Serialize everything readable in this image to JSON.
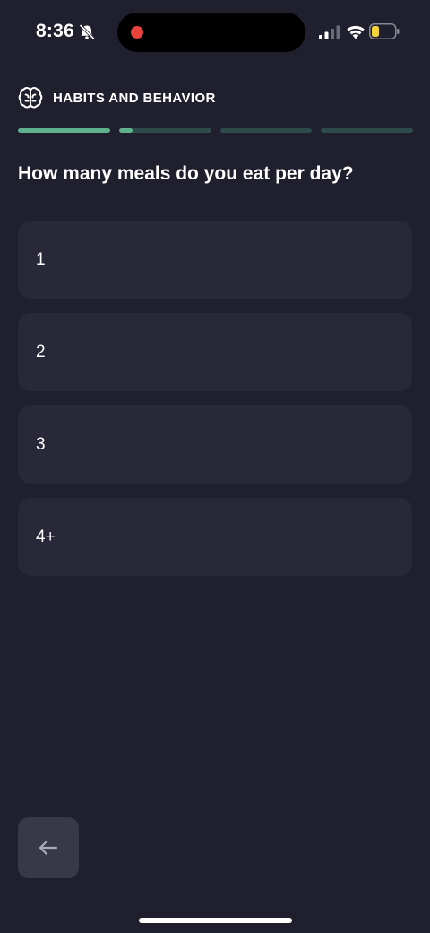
{
  "status_bar": {
    "time": "8:36",
    "icons": [
      "bell-off-icon",
      "signal-icon",
      "wifi-icon",
      "battery-icon"
    ],
    "record_indicator_color": "#e8423a",
    "battery_color": "#f5d33b"
  },
  "header": {
    "icon": "brain-icon",
    "title": "HABITS AND BEHAVIOR"
  },
  "progress": {
    "segments": 4,
    "segment_fill": [
      1.0,
      0.15,
      0,
      0
    ],
    "fill_color": "#5fb08d",
    "track_color": "#2e4a4a"
  },
  "question": "How many meals do you eat per day?",
  "options": [
    {
      "label": "1"
    },
    {
      "label": "2"
    },
    {
      "label": "3"
    },
    {
      "label": "4+"
    }
  ],
  "back_button": {
    "icon": "arrow-left-icon"
  },
  "colors": {
    "background": "#1f1f2e",
    "option_background": "#282839",
    "back_button_background": "#383848"
  }
}
